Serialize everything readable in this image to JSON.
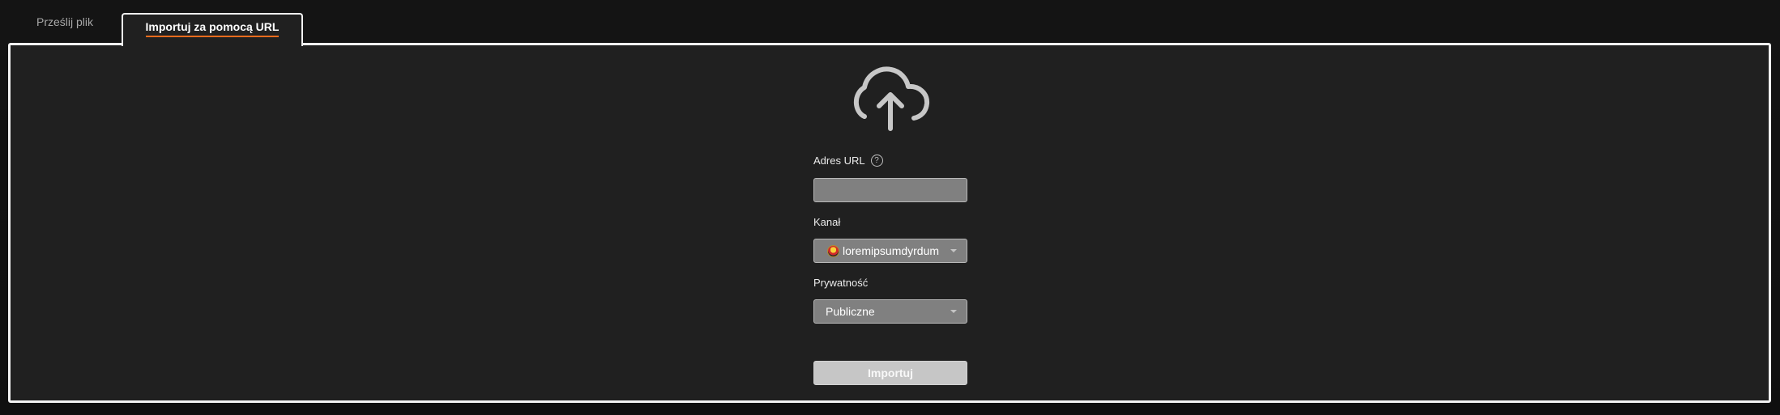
{
  "tabs": [
    {
      "label": "Prześlij plik",
      "active": false
    },
    {
      "label": "Importuj za pomocą URL",
      "active": true
    }
  ],
  "upload_icon": "cloud-upload-icon",
  "fields": {
    "url": {
      "label": "Adres URL",
      "help_icon": "help-circle-icon",
      "help_glyph": "?",
      "value": ""
    },
    "channel": {
      "label": "Kanał",
      "value": "loremipsumdyrdum",
      "avatar": "channel-avatar"
    },
    "privacy": {
      "label": "Prywatność",
      "value": "Publiczne"
    }
  },
  "submit_label": "Importuj",
  "colors": {
    "accent": "#ee6b1d",
    "panel": "#202020",
    "input": "#808080"
  }
}
